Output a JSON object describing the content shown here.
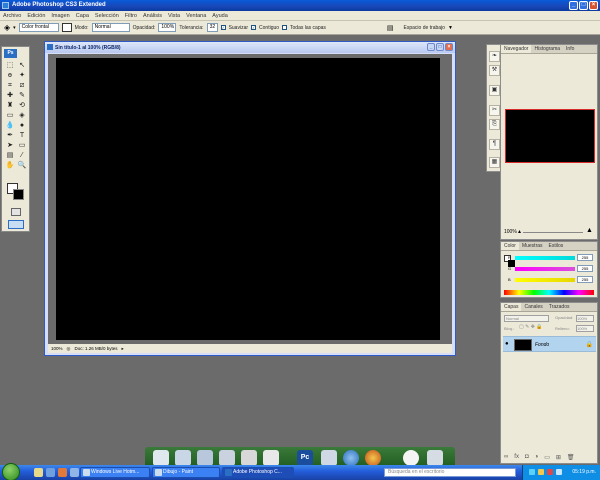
{
  "window": {
    "title": "Adobe Photoshop CS3 Extended",
    "controls": [
      "_",
      "□",
      "×"
    ]
  },
  "menu": [
    "Archivo",
    "Edición",
    "Imagen",
    "Capa",
    "Selección",
    "Filtro",
    "Análisis",
    "Vista",
    "Ventana",
    "Ayuda"
  ],
  "options_bar": {
    "fill_source": "Color frontal",
    "mode_label": "Modo:",
    "mode_value": "Normal",
    "opacity_label": "Opacidad:",
    "opacity_value": "100%",
    "tolerance_label": "Tolerancia:",
    "tolerance_value": "32",
    "antialias_label": "Suavizar",
    "contiguous_label": "Contiguo",
    "all_layers_label": "Todas las capas",
    "workspace_label": "Espacio de trabajo"
  },
  "toolbox": {
    "logo": "Ps"
  },
  "document": {
    "title": "Sin título-1 al 100% (RGB/8)",
    "zoom": "100%",
    "status": "Doc: 1.26 MB/0 bytes"
  },
  "panels": {
    "navigator": {
      "tabs": [
        "Navegador",
        "Histograma",
        "Info"
      ],
      "zoom": "100%"
    },
    "color": {
      "tabs": [
        "Color",
        "Muestras",
        "Estilos"
      ],
      "channels": [
        {
          "label": "R",
          "value": "255",
          "color": "#00d9d9"
        },
        {
          "label": "G",
          "value": "255",
          "color": "#d94fd9"
        },
        {
          "label": "B",
          "value": "255",
          "color": "#e6d600"
        }
      ]
    },
    "layers": {
      "tabs": [
        "Capas",
        "Canales",
        "Trazados"
      ],
      "blend_mode": "Normal",
      "opacity_label": "Opacidad:",
      "opacity_value": "100%",
      "fill_label": "Relleno:",
      "fill_value": "100%",
      "lock_label": "Bloq.:",
      "layer_name": "Fondo"
    }
  },
  "taskbar": {
    "buttons": [
      {
        "label": "Windows Live Hotm..."
      },
      {
        "label": "Dibujo - Paint"
      },
      {
        "label": "Adobe Photoshop C..."
      }
    ],
    "search_placeholder": "Búsqueda en el escritorio",
    "clock": "05:19 p.m."
  }
}
